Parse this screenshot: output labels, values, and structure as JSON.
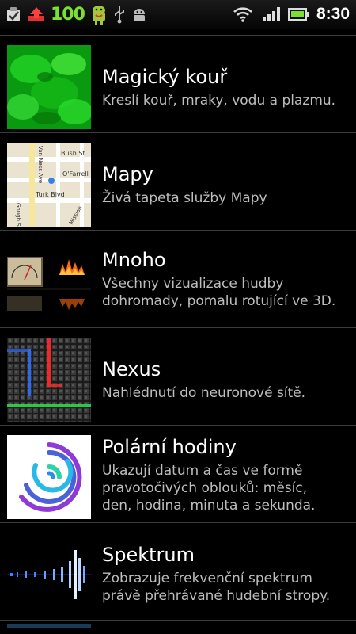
{
  "status_bar": {
    "battery_percent_text": "100",
    "time": "8:30",
    "icons": [
      "checklist-icon",
      "upload-icon",
      "android-mascot-icon",
      "usb-icon",
      "android-debug-icon",
      "wifi-icon",
      "signal-icon",
      "battery-icon"
    ]
  },
  "wallpapers": [
    {
      "title": "Magický kouř",
      "description": "Kreslí kouř, mraky, vodu a plazmu."
    },
    {
      "title": "Mapy",
      "description": "Živá tapeta služby Mapy"
    },
    {
      "title": "Mnoho",
      "description": "Všechny vizualizace hudby\ndohromady, pomalu rotující ve 3D."
    },
    {
      "title": "Nexus",
      "description": "Nahlédnutí do neuronové sítě."
    },
    {
      "title": "Polární hodiny",
      "description": "Ukazují datum a čas ve formě\npravotočivých oblouků: měsíc,\nden, hodina, minuta a sekunda."
    },
    {
      "title": "Spektrum",
      "description": "Zobrazuje frekvenční spektrum\nprávě přehrávané hudební stropy."
    }
  ],
  "map_thumb_labels": [
    "Van Ness Ave",
    "Bush St",
    "O'Farrell",
    "Turk Blvd",
    "Gough St",
    "Mission"
  ],
  "colors": {
    "accent_green": "#7be12e",
    "text_secondary": "#bdbdbd"
  }
}
